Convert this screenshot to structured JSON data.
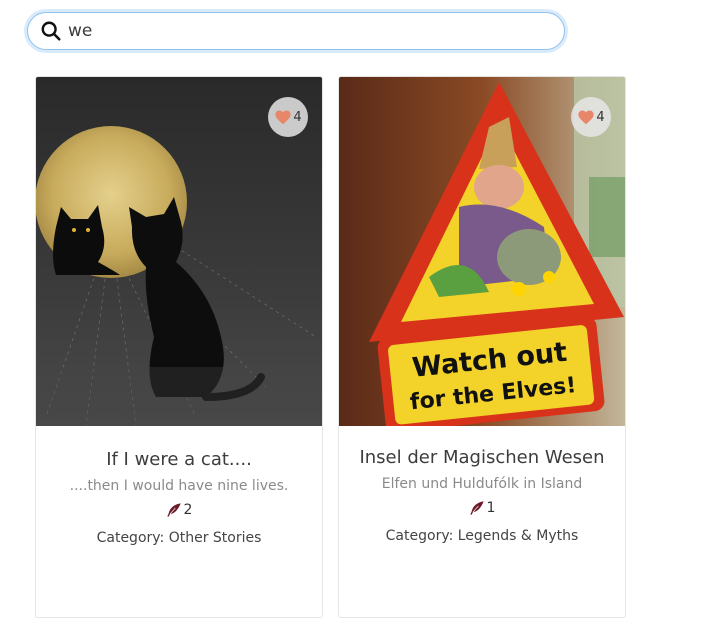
{
  "search": {
    "value": "we",
    "placeholder": ""
  },
  "cards": [
    {
      "likes": "4",
      "title": "If I were a cat....",
      "subtitle": "....then I would have nine lives.",
      "quills": "2",
      "category": "Category: Other Stories"
    },
    {
      "likes": "4",
      "title": "Insel der Magischen Wesen",
      "subtitle": "Elfen und Huldufólk in Island",
      "quills": "1",
      "category": "Category: Legends & Myths",
      "sign_text_line1": "Watch out",
      "sign_text_line2": "for the Elves!"
    }
  ],
  "colors": {
    "heart": "#e8866a",
    "quill": "#6b1a28",
    "accent": "#8ec2ef"
  }
}
